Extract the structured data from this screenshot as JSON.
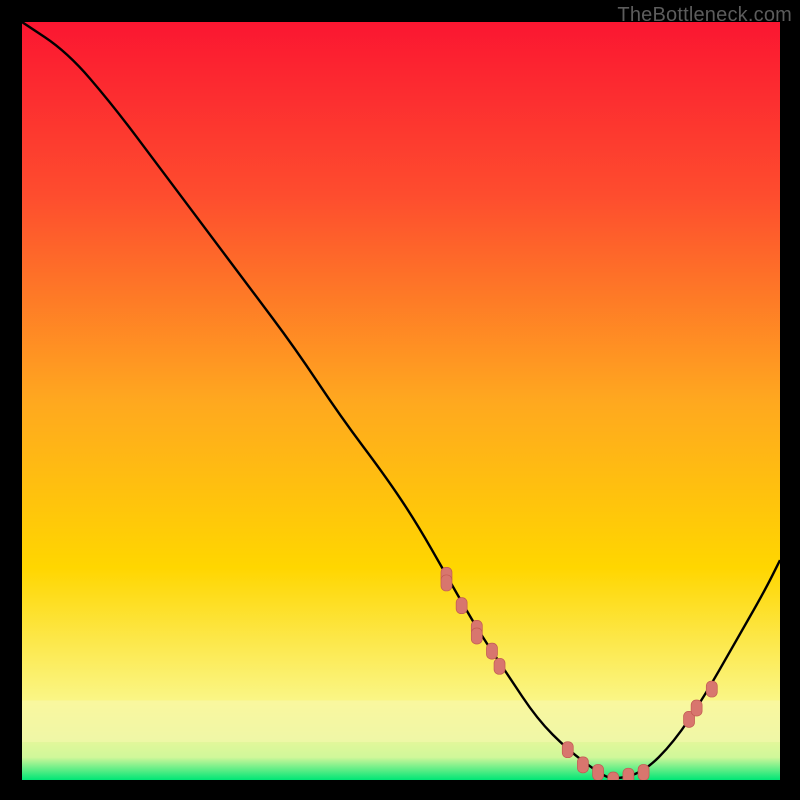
{
  "watermark": "TheBottleneck.com",
  "colors": {
    "gradient_top": "#fb1631",
    "gradient_mid": "#ffd600",
    "gradient_bottom_band_start": "#faf78a",
    "gradient_bottom_light": "#d0f79a",
    "gradient_bottom": "#00e676",
    "curve": "#000000",
    "marker_fill": "#d8766e",
    "marker_stroke": "#c25a52"
  },
  "chart_data": {
    "type": "line",
    "title": "",
    "xlabel": "",
    "ylabel": "",
    "xlim": [
      0,
      100
    ],
    "ylim": [
      0,
      100
    ],
    "grid": false,
    "series": [
      {
        "name": "bottleneck-curve",
        "x": [
          0,
          6,
          12,
          18,
          24,
          30,
          36,
          42,
          48,
          52,
          56,
          60,
          64,
          68,
          72,
          76,
          78,
          82,
          86,
          90,
          94,
          98,
          100
        ],
        "y": [
          100,
          96,
          89,
          81,
          73,
          65,
          57,
          48,
          40,
          34,
          27,
          20,
          14,
          8,
          4,
          1,
          0,
          1,
          5,
          11,
          18,
          25,
          29
        ]
      }
    ],
    "markers": {
      "name": "highlighted-points",
      "x": [
        56,
        56,
        58,
        60,
        60,
        62,
        63,
        72,
        74,
        76,
        78,
        80,
        82,
        88,
        89,
        91
      ],
      "y": [
        27,
        26,
        23,
        20,
        19,
        17,
        15,
        4,
        2,
        1,
        0,
        0.5,
        1,
        8,
        9.5,
        12
      ]
    }
  }
}
